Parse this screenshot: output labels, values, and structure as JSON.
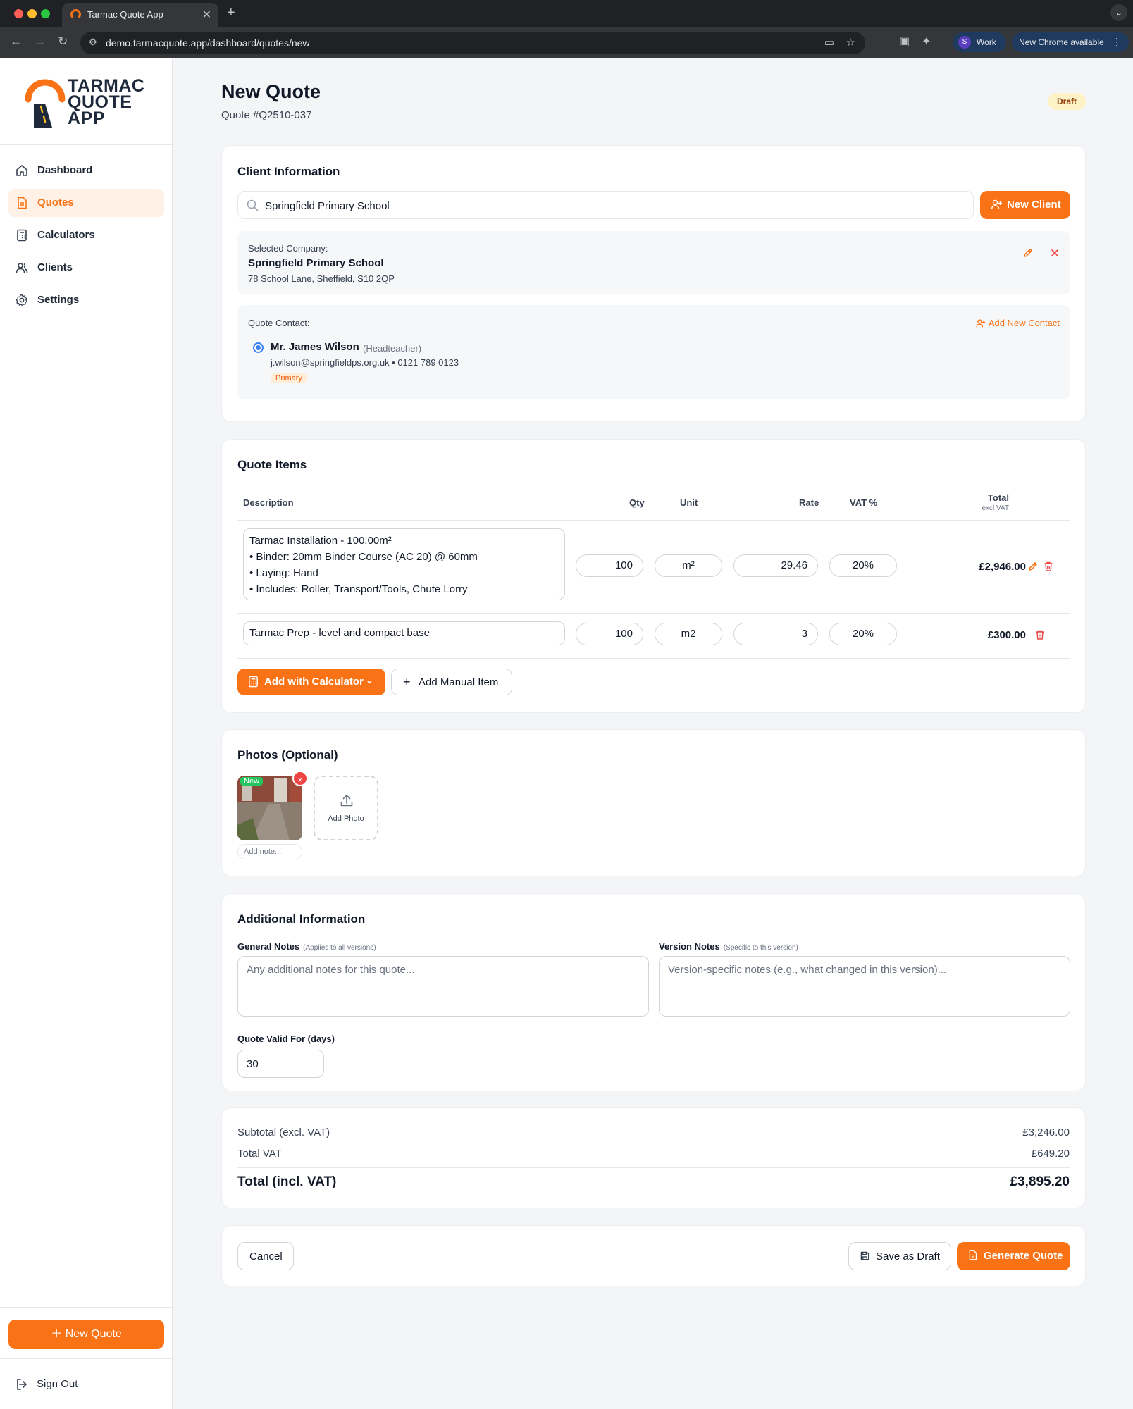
{
  "browser": {
    "tab_title": "Tarmac Quote App",
    "new_tab_label": "+",
    "url": "demo.tarmacquote.app/dashboard/quotes/new",
    "profile_initial": "S",
    "profile_name": "Work",
    "update_label": "New Chrome available"
  },
  "brand": {
    "logo_line1": "TARMAC",
    "logo_line2": "QUOTE",
    "logo_line3": "APP",
    "accent_color": "#f97316",
    "navy_color": "#1e293b"
  },
  "sidebar": {
    "items": [
      {
        "label": "Dashboard",
        "icon": "home-icon"
      },
      {
        "label": "Quotes",
        "icon": "document-icon",
        "active": true
      },
      {
        "label": "Calculators",
        "icon": "calculator-icon"
      },
      {
        "label": "Clients",
        "icon": "users-icon"
      },
      {
        "label": "Settings",
        "icon": "gear-icon"
      }
    ],
    "new_quote_label": "New Quote",
    "sign_out_label": "Sign Out"
  },
  "header": {
    "title": "New Quote",
    "quote_number": "Quote #Q2510-037",
    "status_badge": "Draft"
  },
  "client_info": {
    "title": "Client Information",
    "search_value": "Springfield Primary School",
    "new_client_label": "New Client",
    "selected_company_label": "Selected Company:",
    "company_name": "Springfield Primary School",
    "company_address": "78 School Lane, Sheffield, S10 2QP",
    "quote_contact_label": "Quote Contact:",
    "add_contact_label": "Add New Contact",
    "contact": {
      "name": "Mr. James Wilson",
      "role": "(Headteacher)",
      "details": "j.wilson@springfieldps.org.uk • 0121 789 0123",
      "badge": "Primary"
    }
  },
  "quote_items": {
    "title": "Quote Items",
    "columns": {
      "description": "Description",
      "qty": "Qty",
      "unit": "Unit",
      "rate": "Rate",
      "vat": "VAT %",
      "total": "Total",
      "total_sub": "excl VAT"
    },
    "rows": [
      {
        "description_lines": [
          "Tarmac Installation - 100.00m²",
          "• Binder: 20mm Binder Course (AC 20) @ 60mm",
          "• Laying: Hand",
          "• Includes: Roller, Transport/Tools, Chute Lorry"
        ],
        "qty": "100",
        "unit": "m²",
        "rate": "29.46",
        "vat": "20%",
        "total": "£2,946.00"
      },
      {
        "description_lines": [
          "Tarmac Prep - level and compact base"
        ],
        "qty": "100",
        "unit": "m2",
        "rate": "3",
        "vat": "20%",
        "total": "£300.00"
      }
    ],
    "add_calculator_label": "Add with Calculator",
    "add_manual_label": "Add Manual Item"
  },
  "photos": {
    "title": "Photos (Optional)",
    "new_badge": "New",
    "remove_label": "×",
    "note_placeholder": "Add note...",
    "add_photo_label": "Add Photo"
  },
  "additional_info": {
    "title": "Additional Information",
    "general_notes_label": "General Notes",
    "general_notes_hint": "(Applies to all versions)",
    "general_notes_placeholder": "Any additional notes for this quote...",
    "version_notes_label": "Version Notes",
    "version_notes_hint": "(Specific to this version)",
    "version_notes_placeholder": "Version-specific notes (e.g., what changed in this version)...",
    "valid_for_label": "Quote Valid For (days)",
    "valid_for_value": "30"
  },
  "totals": {
    "subtotal_label": "Subtotal (excl. VAT)",
    "subtotal_value": "£3,246.00",
    "vat_label": "Total VAT",
    "vat_value": "£649.20",
    "grand_label": "Total (incl. VAT)",
    "grand_value": "£3,895.20"
  },
  "actions": {
    "cancel_label": "Cancel",
    "save_draft_label": "Save as Draft",
    "generate_label": "Generate Quote"
  }
}
